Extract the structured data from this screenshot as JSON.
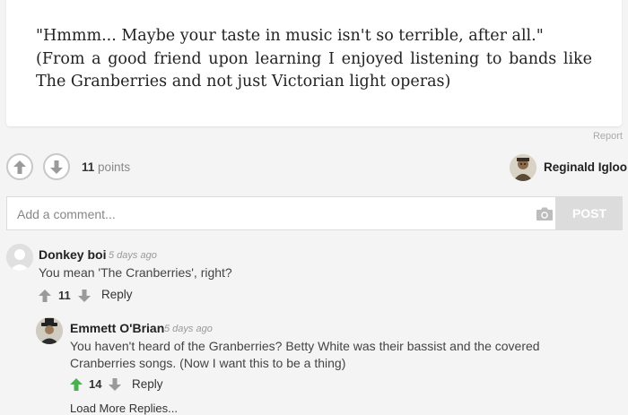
{
  "post": {
    "quote_line1": "\"Hmmm... Maybe your taste in music isn't so terrible, after all.\"",
    "quote_line2": "(From a good friend upon learning I enjoyed listening to bands like The Granberries and not just Victorian light operas)"
  },
  "actions": {
    "report": "Report",
    "points_value": "11",
    "points_label": "points",
    "author_name": "Reginald Igloo"
  },
  "comment_form": {
    "placeholder": "Add a comment...",
    "post_label": "POST"
  },
  "comments": [
    {
      "name": "Donkey boi",
      "time": "5 days ago",
      "text": "You mean 'The Cranberries', right?",
      "votes": "11",
      "reply": "Reply"
    },
    {
      "name": "Emmett O'Brian",
      "time": "5 days ago",
      "text": "You haven't heard of the Granberries? Betty White was their bassist and the covered Cranberries songs. (Now I want this to be a thing)",
      "votes": "14",
      "reply": "Reply"
    }
  ],
  "load_more": "Load More Replies...",
  "colors": {
    "upvote_active": "#4caf50",
    "vote_neutral": "#9a9a9a",
    "post_button": "#dcdcdc"
  }
}
